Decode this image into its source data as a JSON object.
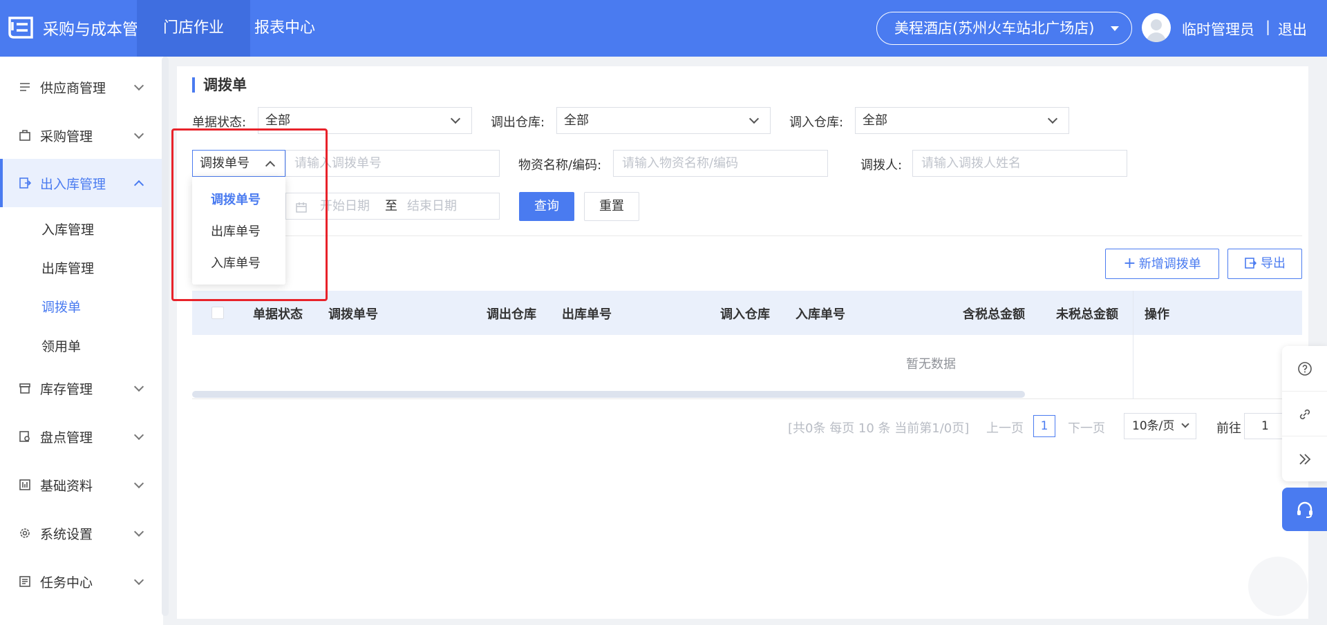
{
  "header": {
    "app_title": "采购与成本管理",
    "tabs": [
      {
        "label": "门店作业",
        "active": true
      },
      {
        "label": "报表中心",
        "active": false
      }
    ],
    "store_name": "美程酒店(苏州火车站北广场店)",
    "user_name": "临时管理员",
    "separator": "|",
    "logout_label": "退出",
    "brand_color": "#4a7bf0"
  },
  "sidebar": {
    "items": [
      {
        "label": "供应商管理",
        "icon": "supplier-icon"
      },
      {
        "label": "采购管理",
        "icon": "purchase-icon"
      },
      {
        "label": "出入库管理",
        "icon": "inout-icon",
        "active": true
      },
      {
        "label": "库存管理",
        "icon": "inventory-icon"
      },
      {
        "label": "盘点管理",
        "icon": "stocktake-icon"
      },
      {
        "label": "基础资料",
        "icon": "basic-data-icon"
      },
      {
        "label": "系统设置",
        "icon": "settings-icon"
      },
      {
        "label": "任务中心",
        "icon": "task-icon"
      }
    ],
    "sub_items": [
      {
        "label": "入库管理"
      },
      {
        "label": "出库管理"
      },
      {
        "label": "调拨单",
        "active": true
      },
      {
        "label": "领用单"
      }
    ]
  },
  "page": {
    "title": "调拨单"
  },
  "filters": {
    "status_label": "单据状态:",
    "status_value": "全部",
    "out_wh_label": "调出仓库:",
    "out_wh_value": "全部",
    "in_wh_label": "调入仓库:",
    "in_wh_value": "全部",
    "type_select_value": "调拨单号",
    "type_placeholder": "请输入调拨单号",
    "material_label": "物资名称/编码:",
    "material_placeholder": "请输入物资名称/编码",
    "person_label": "调拨人:",
    "person_placeholder": "请输入调拨人姓名",
    "date_start_placeholder": "开始日期",
    "date_to": "至",
    "date_end_placeholder": "结束日期",
    "query_label": "查询",
    "reset_label": "重置"
  },
  "dropdown": {
    "options": [
      "调拨单号",
      "出库单号",
      "入库单号"
    ],
    "selected": "调拨单号"
  },
  "actions": {
    "add_label": "新增调拨单",
    "export_label": "导出"
  },
  "table": {
    "columns": [
      "单据状态",
      "调拨单号",
      "调出仓库",
      "出库单号",
      "调入仓库",
      "入库单号",
      "含税总金额",
      "未税总金额",
      "操作"
    ],
    "rows": [],
    "empty_text": "暂无数据"
  },
  "pagination": {
    "summary": "[共0条 每页 10 条 当前第1/0页]",
    "prev_label": "上一页",
    "current_page": "1",
    "next_label": "下一页",
    "page_size": "10条/页",
    "goto_label": "前往",
    "goto_value": "1"
  },
  "highlight_color": "#e8222a"
}
